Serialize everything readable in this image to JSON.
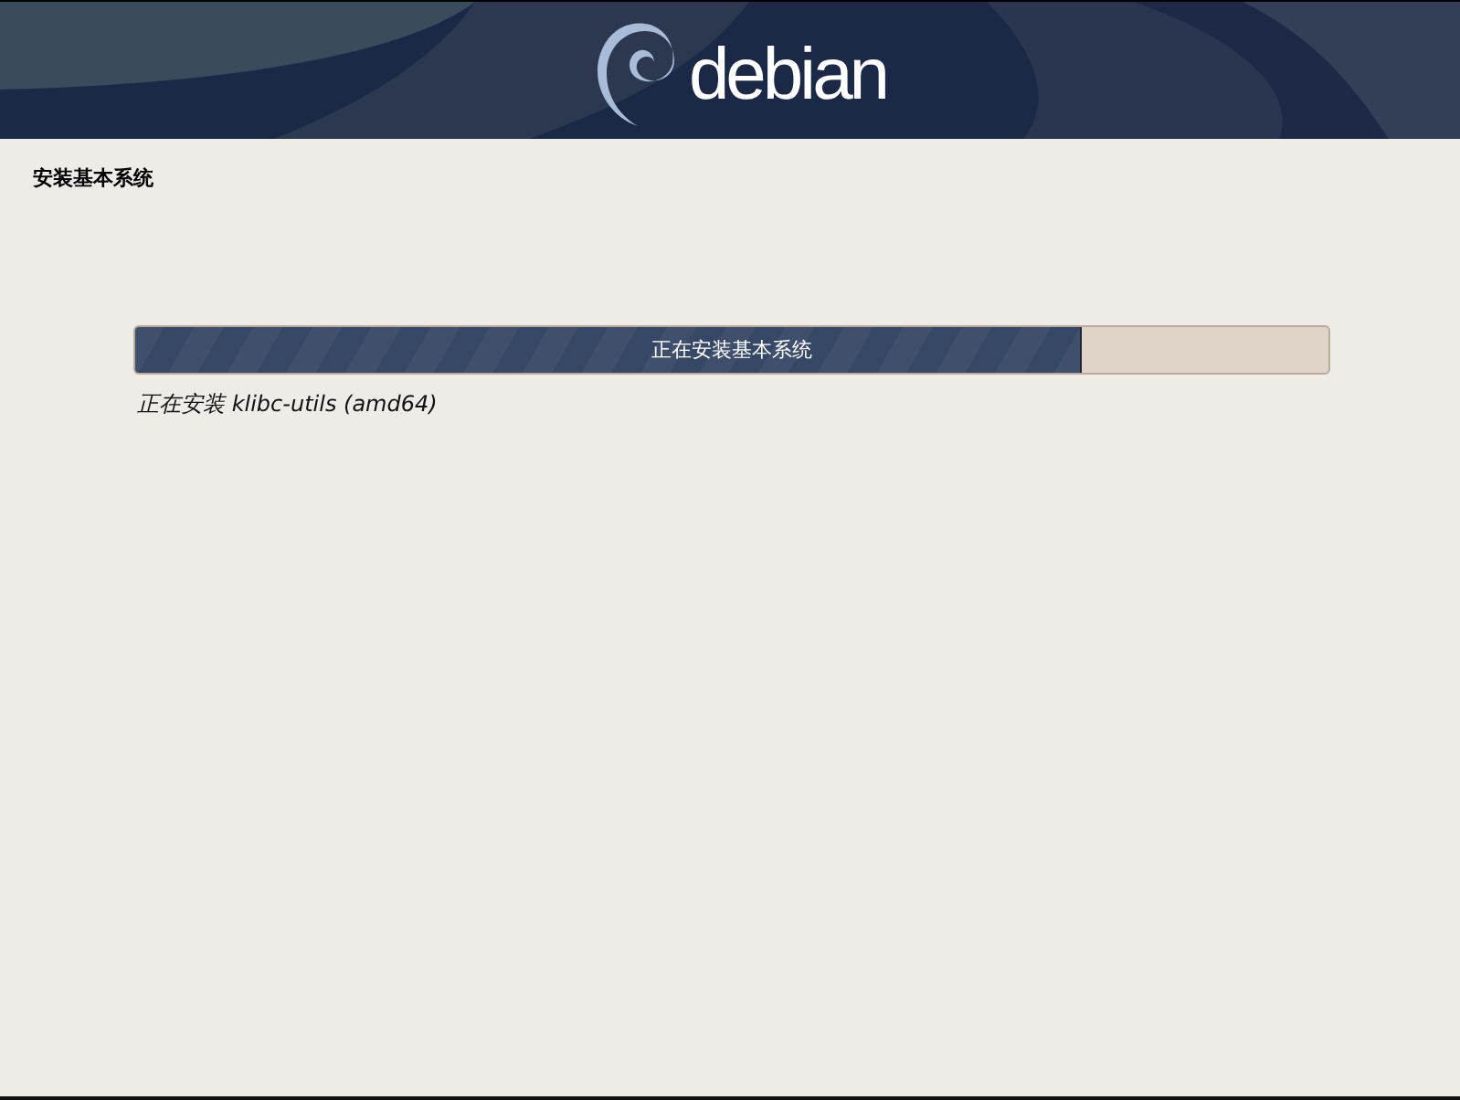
{
  "banner": {
    "logo_text": "debian"
  },
  "step_title": "安装基本系统",
  "progress": {
    "label": "正在安装基本系统",
    "level": 0.792
  },
  "status_text": "正在安装 klibc-utils (amd64)"
}
